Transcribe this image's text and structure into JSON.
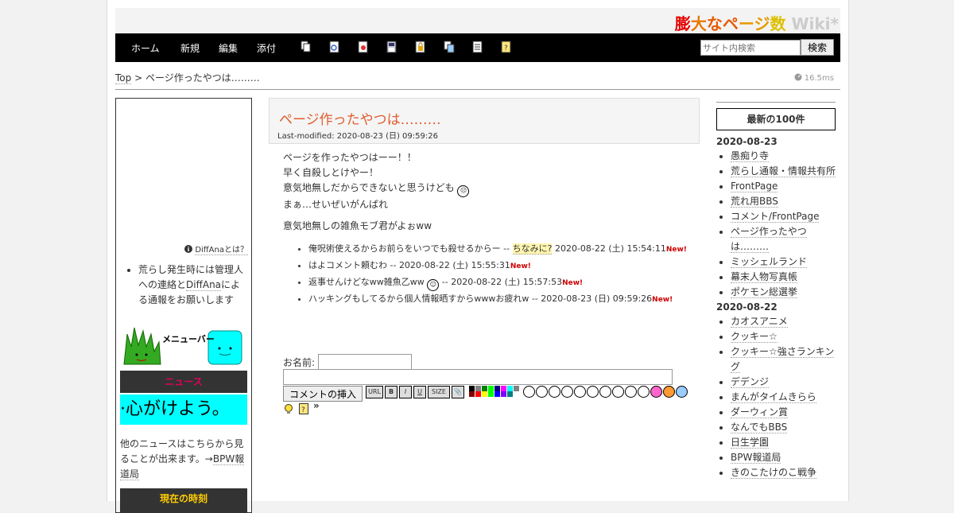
{
  "site": {
    "logo_parts": [
      "膨",
      "大",
      "な",
      "ペ",
      "ー",
      "ジ",
      "数",
      " Wiki*"
    ]
  },
  "nav": {
    "items": [
      "ホーム",
      "新規",
      "編集",
      "添付"
    ],
    "toolbar_icons": [
      "copy-icon",
      "diff-icon",
      "history-icon",
      "backup-icon",
      "freeze-icon",
      "rename-icon",
      "list-icon",
      "help-icon"
    ],
    "search_placeholder": "サイト内検索",
    "search_button": "検索"
  },
  "breadcrumb": {
    "top": "Top",
    "separator": " > ",
    "current": "ページ作ったやつは………"
  },
  "timing": "16.5ms",
  "leftbar": {
    "diffana_link": "DiffAnaとは？",
    "notice_prefix": "荒らし発生時には管理人への連絡と",
    "notice_link": "DiffAna",
    "notice_suffix": "による通報をお願いします",
    "menubar_label": "メニューバー",
    "news_title": "ニュース",
    "news_ticker": "·心がけよう。",
    "news_more_prefix": "他のニュースはこちらから見ることが出来ます。→",
    "news_more_link": "BPW報道局",
    "clock_title": "現在の時刻"
  },
  "page": {
    "title": "ページ作ったやつは………",
    "last_modified": "Last-modified: 2020-08-23 (日) 09:59:26",
    "lines": [
      "ページを作ったやつはーー！！",
      "早く自殺しとけやー！",
      "意気地無しだからできないと思うけども",
      "まぁ…せいぜいがんばれ",
      "意気地無しの雑魚モブ君がよぉww"
    ],
    "comments": [
      {
        "text": "俺呪術使えるからお前らをいつでも殺せるからー -- ",
        "link": "ちなみに?",
        "date": " 2020-08-22 (土) 15:54:11",
        "new": "New!"
      },
      {
        "text": "はよコメント頼むわ -- ",
        "link": "",
        "date": "2020-08-22 (土) 15:55:31",
        "new": "New!"
      },
      {
        "text": "返事せんけどなww雑魚乙ww ",
        "link": "",
        "date": " -- 2020-08-22 (土) 15:57:53",
        "new": "New!"
      },
      {
        "text": "ハッキングもしてるから個人情報晒すからwwwお疲れw -- ",
        "link": "",
        "date": "2020-08-23 (日) 09:59:26",
        "new": "New!"
      }
    ]
  },
  "form": {
    "name_label": "お名前:",
    "submit": "コメントの挿入",
    "fmt_buttons": [
      "URL",
      "B",
      "I",
      "U",
      "SIZE",
      "📎"
    ],
    "swatches": [
      "#000000",
      "#808080",
      "#008000",
      "#00ff00",
      "#000080",
      "#ff00ff",
      "#00ffff",
      "#808080",
      "#800000",
      "#ff0000",
      "#ffff00",
      "#00ff00",
      "#0000ff",
      "#8000ff",
      "#008080",
      "#ffffff"
    ],
    "more": "»"
  },
  "rightbar": {
    "title": "最新の100件",
    "groups": [
      {
        "date": "2020-08-23",
        "items": [
          "愚痴り寺",
          "荒らし通報・情報共有所",
          "FrontPage",
          "荒れ用BBS",
          "コメント/FrontPage",
          "ページ作ったやつは………",
          "ミッシェルランド",
          "幕末人物写真帳",
          "ポケモン総選挙"
        ]
      },
      {
        "date": "2020-08-22",
        "items": [
          "カオスアニメ",
          "クッキー☆",
          "クッキー☆強さランキング",
          "デデンジ",
          "まんがタイムきらら",
          "ダーウィン賞",
          "なんでもBBS",
          "日生学園",
          "BPW報道局",
          "きのこたけのこ戦争"
        ]
      }
    ]
  }
}
